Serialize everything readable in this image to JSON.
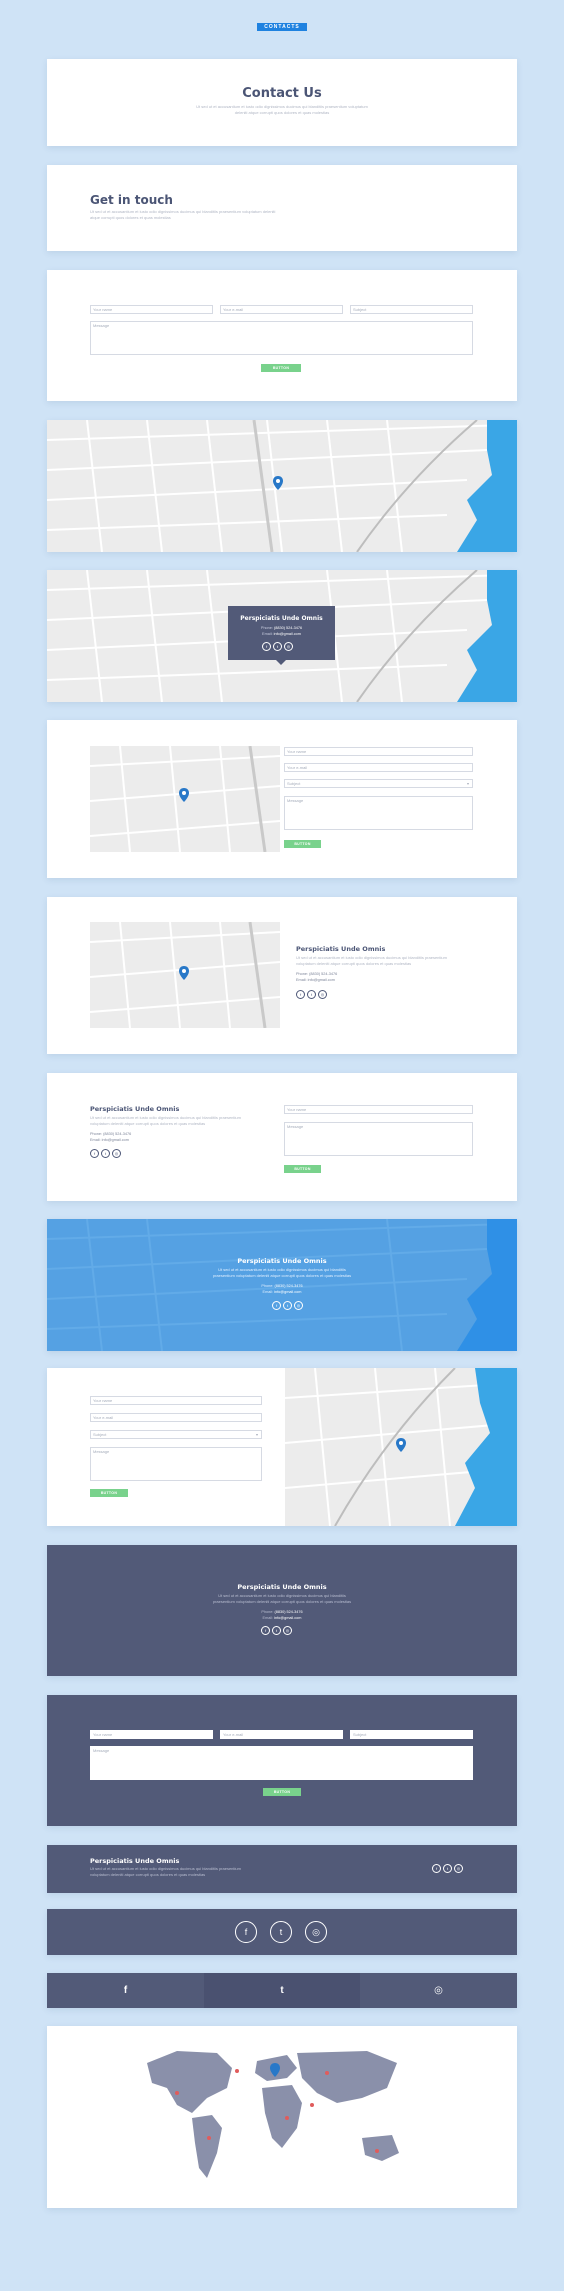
{
  "header": {
    "tag": "CONTACTS"
  },
  "lorem_short": "Lo sed ut et accusantium et iusto odio dignissimos ducimus qui blanditiis praesentium voluptatum deleniti atque corrupti quos dolores quas molestias",
  "lorem_two": "Ut sed ut et accusantium et iusto odio dignissimos ducimus qui blanditiis praesentium voluptatum deleniti atque corrupti quos dolores et quas molestias",
  "contact_us": {
    "title": "Contact Us"
  },
  "get_in_touch": {
    "title": "Get in touch"
  },
  "form": {
    "name_placeholder": "Your name",
    "email_placeholder": "Your e-mail",
    "subject_placeholder": "Subject",
    "message_placeholder": "Message",
    "button": "BUTTON"
  },
  "company": {
    "name": "Perspiciatis Unde Omnis",
    "phone_label": "Phone:",
    "phone": "(8830) 524-3476",
    "email_label": "Email:",
    "email": "info@gmail.com"
  },
  "social": {
    "facebook": "f",
    "twitter": "t",
    "instagram": "◎"
  },
  "colors": {
    "accent": "#1f82e0",
    "pin": "#2878c8",
    "dark": "#525a78",
    "button": "#79d28c",
    "blue_section": "#55a1e3"
  },
  "icons": [
    "map-pin-icon",
    "facebook-icon",
    "twitter-icon",
    "instagram-icon"
  ]
}
